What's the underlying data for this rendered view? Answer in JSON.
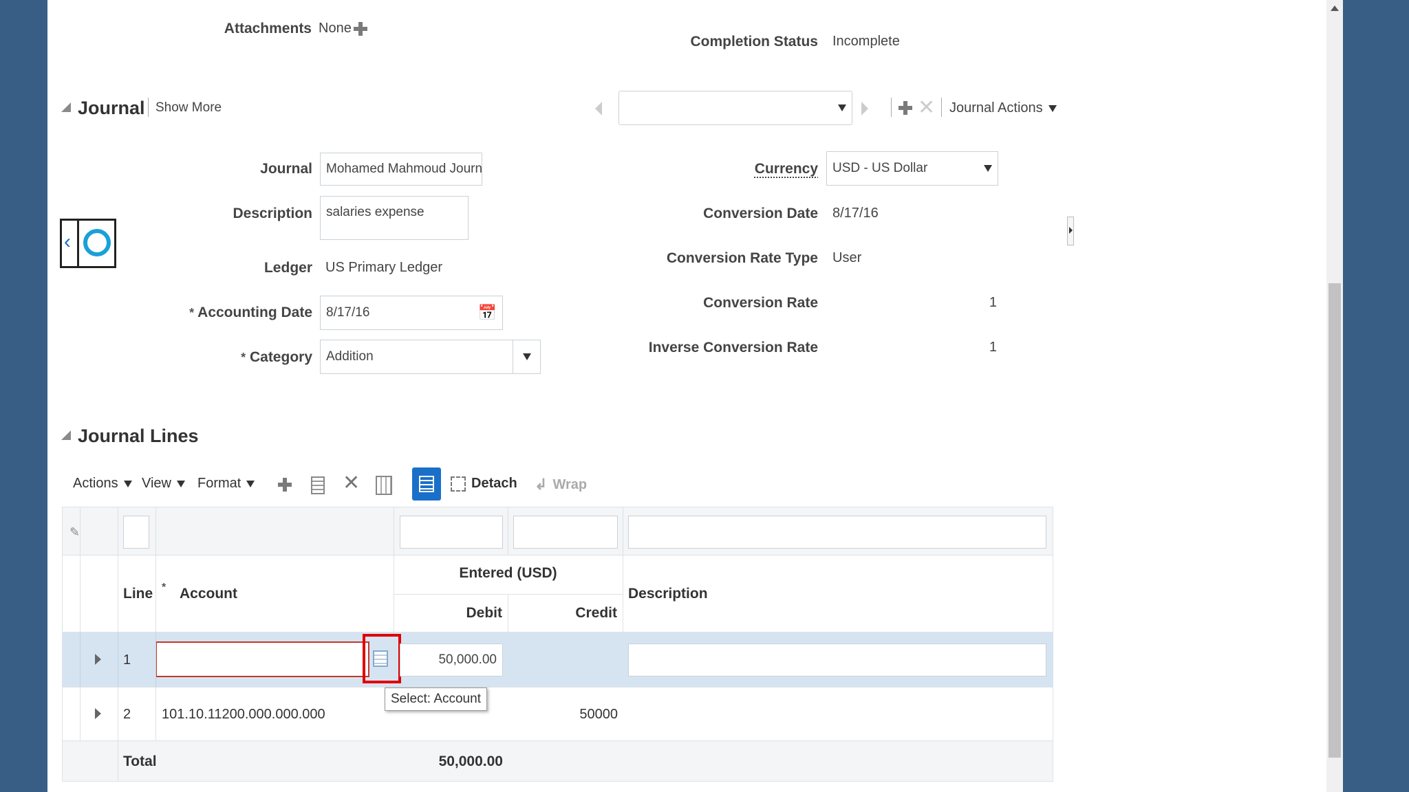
{
  "header": {
    "attachments_label": "Attachments",
    "attachments_value": "None",
    "completion_status_label": "Completion Status",
    "completion_status_value": "Incomplete"
  },
  "journal": {
    "section_title": "Journal",
    "show_more": "Show More",
    "journal_actions": "Journal Actions",
    "fields": {
      "journal_label": "Journal",
      "journal_value": "Mohamed Mahmoud Journ",
      "description_label": "Description",
      "description_value": "salaries expense",
      "ledger_label": "Ledger",
      "ledger_value": "US Primary Ledger",
      "accounting_date_label": "Accounting Date",
      "accounting_date_value": "8/17/16",
      "category_label": "Category",
      "category_value": "Addition",
      "currency_label": "Currency",
      "currency_value": "USD - US Dollar",
      "conversion_date_label": "Conversion Date",
      "conversion_date_value": "8/17/16",
      "conversion_rate_type_label": "Conversion Rate Type",
      "conversion_rate_type_value": "User",
      "conversion_rate_label": "Conversion Rate",
      "conversion_rate_value": "1",
      "inverse_conversion_rate_label": "Inverse Conversion Rate",
      "inverse_conversion_rate_value": "1"
    },
    "required_mark": "*"
  },
  "journal_lines": {
    "section_title": "Journal Lines",
    "toolbar": {
      "actions": "Actions",
      "view": "View",
      "format": "Format",
      "detach": "Detach",
      "wrap": "Wrap"
    },
    "columns": {
      "line": "Line",
      "account": "Account",
      "entered_group": "Entered (USD)",
      "debit": "Debit",
      "credit": "Credit",
      "description": "Description"
    },
    "rows": [
      {
        "line": "1",
        "account": "",
        "debit": "50,000.00",
        "credit": "",
        "description": ""
      },
      {
        "line": "2",
        "account": "101.10.11200.000.000.000",
        "debit": "",
        "credit": "50000",
        "description": ""
      }
    ],
    "total_label": "Total",
    "total_debit": "50,000.00",
    "tooltip": "Select: Account"
  },
  "colors": {
    "background": "#385e86",
    "selected_row": "#d6e4f2",
    "highlight_box": "#e00000",
    "accent": "#1a6fc9"
  }
}
